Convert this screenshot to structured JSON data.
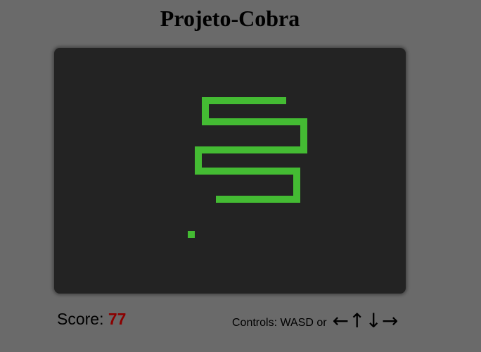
{
  "title": "Projeto-Cobra",
  "score": {
    "label": "Score: ",
    "value": "77"
  },
  "controls": {
    "label": "Controls: WASD or",
    "arrows": [
      "←",
      "↑",
      "↓",
      "→"
    ]
  },
  "colors": {
    "background": "#6a6a6a",
    "board": "#232323",
    "snake": "#44bb33",
    "food": "#44bb33",
    "score_value": "#8b0000"
  }
}
